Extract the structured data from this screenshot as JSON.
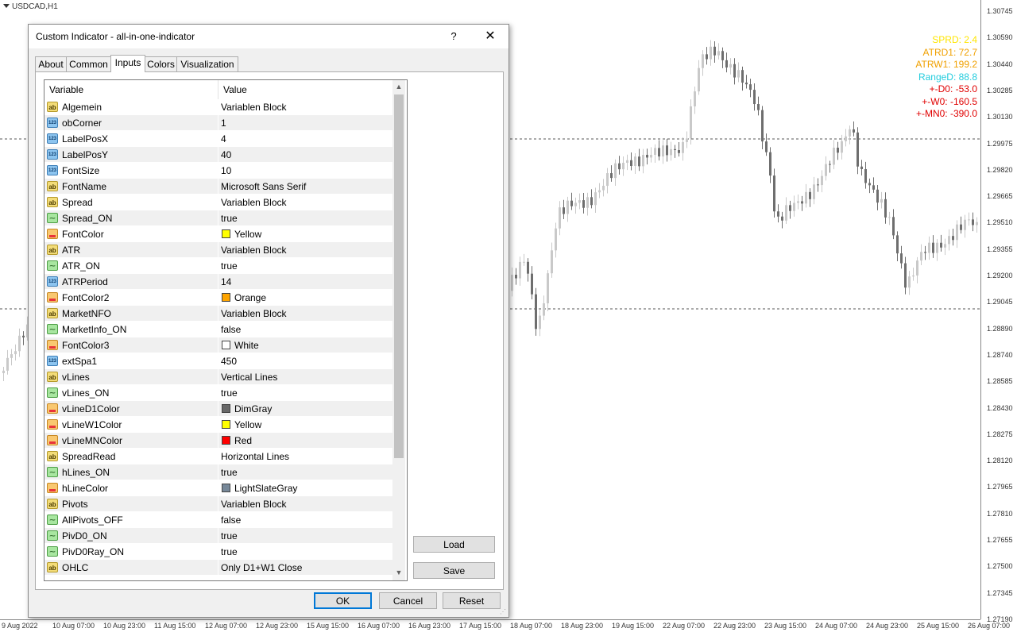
{
  "chart": {
    "symbol": "USDCAD,H1",
    "colors": {
      "up": "#c9c9c9",
      "down": "#6e6e6e",
      "hline": "#555555"
    },
    "price_labels": [
      "1.30745",
      "1.30590",
      "1.30440",
      "1.30285",
      "1.30130",
      "1.29975",
      "1.29820",
      "1.29665",
      "1.29510",
      "1.29355",
      "1.29200",
      "1.29045",
      "1.28890",
      "1.28740",
      "1.28585",
      "1.28430",
      "1.28275",
      "1.28120",
      "1.27965",
      "1.27810",
      "1.27655",
      "1.27500",
      "1.27345",
      "1.27190"
    ],
    "time_labels": [
      "9 Aug 2022",
      "10 Aug 07:00",
      "10 Aug 23:00",
      "11 Aug 15:00",
      "12 Aug 07:00",
      "12 Aug 23:00",
      "15 Aug 15:00",
      "16 Aug 07:00",
      "16 Aug 23:00",
      "17 Aug 15:00",
      "18 Aug 07:00",
      "18 Aug 23:00",
      "19 Aug 15:00",
      "22 Aug 07:00",
      "22 Aug 23:00",
      "23 Aug 15:00",
      "24 Aug 07:00",
      "24 Aug 23:00",
      "25 Aug 15:00",
      "26 Aug 07:00"
    ],
    "indicator_lines": [
      {
        "text": "SPRD: 2.4",
        "color": "#ffe600"
      },
      {
        "text": "ATRD1: 72.7",
        "color": "#f0a000"
      },
      {
        "text": "ATRW1: 199.2",
        "color": "#f0a000"
      },
      {
        "text": "RangeD: 88.8",
        "color": "#22ccdd"
      },
      {
        "text": "+-D0: -53.0",
        "color": "#e00000"
      },
      {
        "text": "+-W0: -160.5",
        "color": "#e00000"
      },
      {
        "text": "+-MN0: -390.0",
        "color": "#e00000"
      }
    ]
  },
  "dialog": {
    "title": "Custom Indicator - all-in-one-indicator",
    "help_label": "?",
    "close_label": "✕",
    "tabs": [
      {
        "label": "About",
        "active": false
      },
      {
        "label": "Common",
        "active": false
      },
      {
        "label": "Inputs",
        "active": true
      },
      {
        "label": "Colors",
        "active": false
      },
      {
        "label": "Visualization",
        "active": false
      }
    ],
    "grid": {
      "col_variable": "Variable",
      "col_value": "Value",
      "rows": [
        {
          "icon": "ab",
          "name": "Algemein",
          "value": "Variablen Block"
        },
        {
          "icon": "num",
          "name": "obCorner",
          "value": "1"
        },
        {
          "icon": "num",
          "name": "LabelPosX",
          "value": "4"
        },
        {
          "icon": "num",
          "name": "LabelPosY",
          "value": "40"
        },
        {
          "icon": "num",
          "name": "FontSize",
          "value": "10"
        },
        {
          "icon": "ab",
          "name": "FontName",
          "value": "Microsoft Sans Serif"
        },
        {
          "icon": "ab",
          "name": "Spread",
          "value": "Variablen Block"
        },
        {
          "icon": "bool",
          "name": "Spread_ON",
          "value": "true"
        },
        {
          "icon": "color",
          "name": "FontColor",
          "value": "Yellow",
          "swatch": "#ffff00"
        },
        {
          "icon": "ab",
          "name": "ATR",
          "value": "Variablen Block"
        },
        {
          "icon": "bool",
          "name": "ATR_ON",
          "value": "true"
        },
        {
          "icon": "num",
          "name": "ATRPeriod",
          "value": "14"
        },
        {
          "icon": "color",
          "name": "FontColor2",
          "value": "Orange",
          "swatch": "#ffa500"
        },
        {
          "icon": "ab",
          "name": "MarketNFO",
          "value": "Variablen Block"
        },
        {
          "icon": "bool",
          "name": "MarketInfo_ON",
          "value": "false"
        },
        {
          "icon": "color",
          "name": "FontColor3",
          "value": "White",
          "swatch": "#ffffff"
        },
        {
          "icon": "num",
          "name": "extSpa1",
          "value": "450"
        },
        {
          "icon": "ab",
          "name": "vLines",
          "value": "Vertical Lines"
        },
        {
          "icon": "bool",
          "name": "vLines_ON",
          "value": "true"
        },
        {
          "icon": "color",
          "name": "vLineD1Color",
          "value": "DimGray",
          "swatch": "#696969"
        },
        {
          "icon": "color",
          "name": "vLineW1Color",
          "value": "Yellow",
          "swatch": "#ffff00"
        },
        {
          "icon": "color",
          "name": "vLineMNColor",
          "value": "Red",
          "swatch": "#ff0000"
        },
        {
          "icon": "ab",
          "name": "SpreadRead",
          "value": "Horizontal Lines"
        },
        {
          "icon": "bool",
          "name": "hLines_ON",
          "value": "true"
        },
        {
          "icon": "color",
          "name": "hLineColor",
          "value": "LightSlateGray",
          "swatch": "#778899"
        },
        {
          "icon": "ab",
          "name": "Pivots",
          "value": "Variablen Block"
        },
        {
          "icon": "bool",
          "name": "AllPivots_OFF",
          "value": "false"
        },
        {
          "icon": "bool",
          "name": "PivD0_ON",
          "value": "true"
        },
        {
          "icon": "bool",
          "name": "PivD0Ray_ON",
          "value": "true"
        },
        {
          "icon": "ab",
          "name": "OHLC",
          "value": "Only D1+W1 Close"
        }
      ]
    },
    "buttons": {
      "load": "Load",
      "save": "Save",
      "ok": "OK",
      "cancel": "Cancel",
      "reset": "Reset"
    }
  }
}
